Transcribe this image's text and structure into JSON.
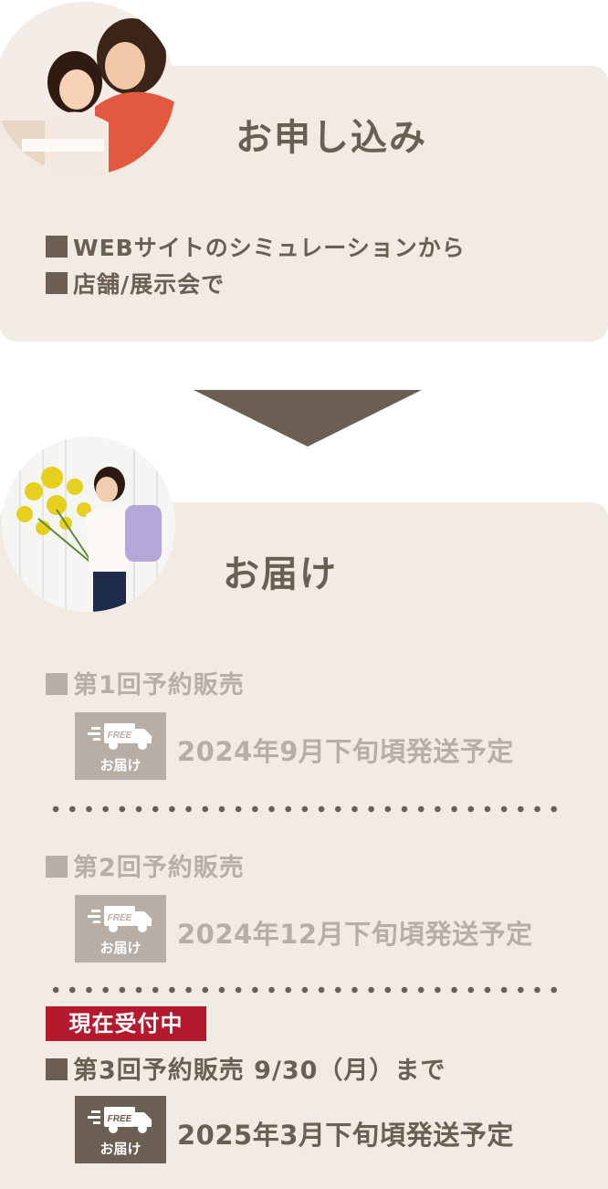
{
  "apply": {
    "title": "お申し込み",
    "items": [
      "WEBサイトのシミュレーションから",
      "店舗/展示会で"
    ]
  },
  "delivery": {
    "title": "お届け",
    "icon": {
      "name": "free-delivery-truck-icon",
      "top_text": "FREE",
      "bottom_text": "お届け"
    },
    "rounds": [
      {
        "label": "第1回予約販売",
        "date": "2024年9月下旬頃発送予定",
        "active": false
      },
      {
        "label": "第2回予約販売",
        "date": "2024年12月下旬頃発送予定",
        "active": false
      },
      {
        "label": "第3回予約販売 9/30（月）まで",
        "date": "2025年3月下旬頃発送予定",
        "active": true,
        "badge": "現在受付中"
      }
    ]
  },
  "colors": {
    "card_bg": "#f2ebe3",
    "text_brown": "#6b5e52",
    "text_muted": "#b8aea5",
    "badge_red": "#b5192e"
  }
}
